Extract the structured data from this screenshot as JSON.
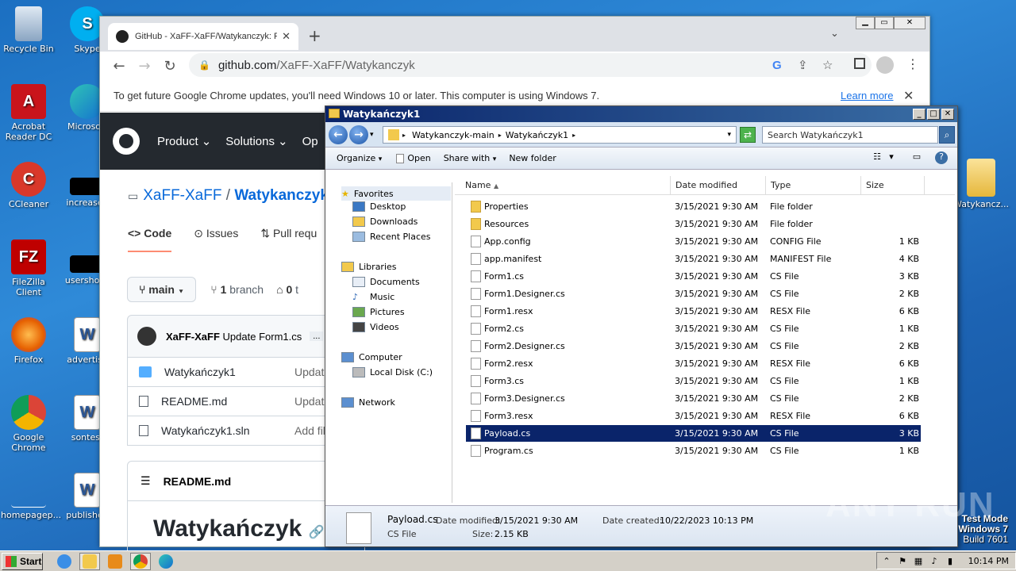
{
  "desktop": {
    "icons": [
      {
        "label": "Recycle Bin"
      },
      {
        "label": "Skype"
      },
      {
        "label": "Acrobat Reader DC"
      },
      {
        "label": "Microsoft"
      },
      {
        "label": "CCleaner"
      },
      {
        "label": "increased"
      },
      {
        "label": "FileZilla Client"
      },
      {
        "label": "usershosp"
      },
      {
        "label": "Firefox"
      },
      {
        "label": "advertise"
      },
      {
        "label": "Google Chrome"
      },
      {
        "label": "sontest"
      },
      {
        "label": "homepagep..."
      },
      {
        "label": "published"
      },
      {
        "label": "Watykancz..."
      }
    ],
    "watermark": {
      "line1": "Test Mode",
      "line2": "Windows 7",
      "line3": "Build 7601"
    },
    "anyrun": "ANY RUN"
  },
  "chrome": {
    "tab_title": "GitHub - XaFF-XaFF/Watykanczyk: R",
    "tab_close": "✕",
    "new_tab": "+",
    "url_host": "github.com",
    "url_path": "/XaFF-XaFF/Watykanczyk",
    "infobar_text": "To get future Google Chrome updates, you'll need Windows 10 or later. This computer is using Windows 7.",
    "infobar_link": "Learn more",
    "gh_nav": [
      "Product",
      "Solutions",
      "Op"
    ],
    "repo_owner": "XaFF-XaFF",
    "repo_sep": " / ",
    "repo_name": "Watykanczyk",
    "tabs": [
      "Code",
      "Issues",
      "Pull requ"
    ],
    "branch": "main",
    "branch_count": "1",
    "branch_word": "branch",
    "tag_count": "0",
    "tag_word": "t",
    "commit_author": "XaFF-XaFF",
    "commit_msg": "Update Form1.cs",
    "commit_more": "...",
    "files": [
      {
        "name": "Watykańczyk1",
        "commit": "Updat",
        "type": "folder"
      },
      {
        "name": "README.md",
        "commit": "Updat",
        "type": "file"
      },
      {
        "name": "Watykańczyk1.sln",
        "commit": "Add fil",
        "type": "file"
      }
    ],
    "readme_header": "README.md",
    "readme_title": "Watykańczyk"
  },
  "explorer": {
    "title": "Watykańczyk1",
    "breadcrumb": [
      "Watykanczyk-main",
      "Watykańczyk1"
    ],
    "search_placeholder": "Search Watykańczyk1",
    "commands": [
      "Organize",
      "Open",
      "Share with",
      "New folder"
    ],
    "nav": {
      "favorites": "Favorites",
      "favorites_items": [
        "Desktop",
        "Downloads",
        "Recent Places"
      ],
      "libraries": "Libraries",
      "libraries_items": [
        "Documents",
        "Music",
        "Pictures",
        "Videos"
      ],
      "computer": "Computer",
      "computer_items": [
        "Local Disk (C:)"
      ],
      "network": "Network"
    },
    "columns": [
      "Name",
      "Date modified",
      "Type",
      "Size"
    ],
    "files": [
      {
        "name": "Properties",
        "date": "3/15/2021 9:30 AM",
        "type": "File folder",
        "size": "",
        "kind": "folder"
      },
      {
        "name": "Resources",
        "date": "3/15/2021 9:30 AM",
        "type": "File folder",
        "size": "",
        "kind": "folder"
      },
      {
        "name": "App.config",
        "date": "3/15/2021 9:30 AM",
        "type": "CONFIG File",
        "size": "1 KB",
        "kind": "file"
      },
      {
        "name": "app.manifest",
        "date": "3/15/2021 9:30 AM",
        "type": "MANIFEST File",
        "size": "4 KB",
        "kind": "file"
      },
      {
        "name": "Form1.cs",
        "date": "3/15/2021 9:30 AM",
        "type": "CS File",
        "size": "3 KB",
        "kind": "file"
      },
      {
        "name": "Form1.Designer.cs",
        "date": "3/15/2021 9:30 AM",
        "type": "CS File",
        "size": "2 KB",
        "kind": "file"
      },
      {
        "name": "Form1.resx",
        "date": "3/15/2021 9:30 AM",
        "type": "RESX File",
        "size": "6 KB",
        "kind": "file"
      },
      {
        "name": "Form2.cs",
        "date": "3/15/2021 9:30 AM",
        "type": "CS File",
        "size": "1 KB",
        "kind": "file"
      },
      {
        "name": "Form2.Designer.cs",
        "date": "3/15/2021 9:30 AM",
        "type": "CS File",
        "size": "2 KB",
        "kind": "file"
      },
      {
        "name": "Form2.resx",
        "date": "3/15/2021 9:30 AM",
        "type": "RESX File",
        "size": "6 KB",
        "kind": "file"
      },
      {
        "name": "Form3.cs",
        "date": "3/15/2021 9:30 AM",
        "type": "CS File",
        "size": "1 KB",
        "kind": "file"
      },
      {
        "name": "Form3.Designer.cs",
        "date": "3/15/2021 9:30 AM",
        "type": "CS File",
        "size": "2 KB",
        "kind": "file"
      },
      {
        "name": "Form3.resx",
        "date": "3/15/2021 9:30 AM",
        "type": "RESX File",
        "size": "6 KB",
        "kind": "file"
      },
      {
        "name": "Payload.cs",
        "date": "3/15/2021 9:30 AM",
        "type": "CS File",
        "size": "3 KB",
        "kind": "file",
        "selected": true
      },
      {
        "name": "Program.cs",
        "date": "3/15/2021 9:30 AM",
        "type": "CS File",
        "size": "1 KB",
        "kind": "file"
      }
    ],
    "details": {
      "name": "Payload.cs",
      "type": "CS File",
      "date_modified_label": "Date modified:",
      "date_modified": "3/15/2021 9:30 AM",
      "size_label": "Size:",
      "size": "2.15 KB",
      "date_created_label": "Date created:",
      "date_created": "10/22/2023 10:13 PM"
    }
  },
  "taskbar": {
    "start": "Start",
    "clock": "10:14 PM"
  }
}
